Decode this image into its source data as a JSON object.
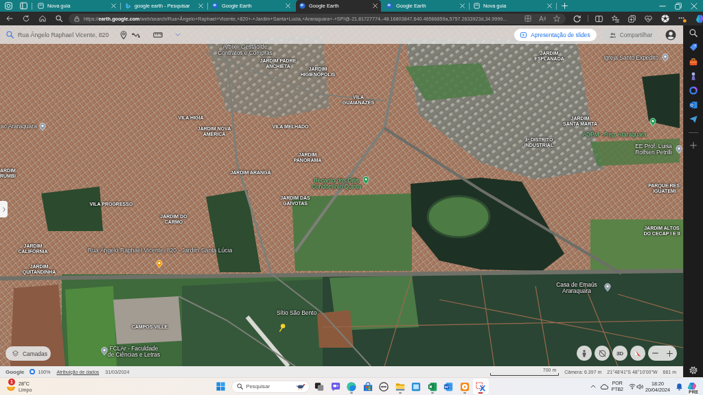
{
  "browser": {
    "tabs": [
      {
        "kind": "new-tab",
        "title": "Nova guia",
        "selected": false
      },
      {
        "kind": "search",
        "title": "google earth - Pesquisar",
        "selected": false
      },
      {
        "kind": "earth",
        "title": "Google Earth",
        "selected": false
      },
      {
        "kind": "earth",
        "title": "Google Earth",
        "selected": true
      },
      {
        "kind": "earth",
        "title": "Google Earth",
        "selected": false
      },
      {
        "kind": "new-tab",
        "title": "Nova guia",
        "selected": false
      }
    ],
    "address_bar": {
      "url": "https://**earth.google.com**/web/search/Rua+Ângelo+Raphael+Vicente,+820+-+Jardim+Santa+Lucia,+Araraquara+-+SP/@-21.81727774,-48.16803847,640.46566859a,5757.2633923d,34.9999..."
    }
  },
  "earth": {
    "search": {
      "value": "Rua Ângelo Raphael Vicente, 820"
    },
    "slideshow_button": "Apresentação de slides",
    "share_button": {
      "label": "Compartilhar",
      "disabled": true
    },
    "map_labels": [
      {
        "kind": "place",
        "lines": [
          "Arbix - Gestão de",
          "Contratos e Compras"
        ]
      },
      {
        "kind": "district",
        "lines": [
          "JARDIM PADRE",
          "ANCHIETA"
        ]
      },
      {
        "kind": "district",
        "lines": [
          "JARDIM",
          "HIGIENÓPOLIS"
        ]
      },
      {
        "kind": "district",
        "lines": [
          "JARDIM",
          "ESPLANADA"
        ]
      },
      {
        "kind": "place",
        "lines": [
          "Igreja Santo Expedito"
        ]
      },
      {
        "kind": "district",
        "lines": [
          "VILA",
          "GUAIANAZES"
        ]
      },
      {
        "kind": "district",
        "lines": [
          "VILA HIGIA"
        ]
      },
      {
        "kind": "district",
        "lines": [
          "JARDIM",
          "SANTA MARTA"
        ]
      },
      {
        "kind": "place",
        "lines": [
          "ac Araraquara"
        ]
      },
      {
        "kind": "district",
        "lines": [
          "VILA MELHADO"
        ]
      },
      {
        "kind": "district",
        "lines": [
          "JARDIM NOVA",
          "AMÉRICA"
        ]
      },
      {
        "kind": "business",
        "lines": [
          "ADPM - Reg. Araraquara"
        ]
      },
      {
        "kind": "district",
        "lines": [
          "3º DISTRITO",
          "INDUSTRIAL"
        ]
      },
      {
        "kind": "place",
        "lines": [
          "EE Prof. Luisa",
          "Rolfsen Petrilli"
        ]
      },
      {
        "kind": "district",
        "lines": [
          "JARDIM",
          "PANORAMA"
        ]
      },
      {
        "kind": "district",
        "lines": [
          "ARDIM",
          "RUMBI"
        ]
      },
      {
        "kind": "district",
        "lines": [
          "JARDIM ARANGÁ"
        ]
      },
      {
        "kind": "business",
        "lines": [
          "Recanto dos Oitis",
          "Condomínio Quinta"
        ]
      },
      {
        "kind": "district",
        "lines": [
          "PARQUE RES.",
          "IGUATEMI"
        ]
      },
      {
        "kind": "district",
        "lines": [
          "VILA PROGRESSO"
        ]
      },
      {
        "kind": "district",
        "lines": [
          "JARDIM DAS",
          "GAIVOTAS"
        ]
      },
      {
        "kind": "district",
        "lines": [
          "JARDIM DO",
          "CARMO"
        ]
      },
      {
        "kind": "district",
        "lines": [
          "JARDIM ALTOS",
          "DO CECAP I E II"
        ]
      },
      {
        "kind": "district",
        "lines": [
          "JARDIM",
          "CALIFÓRNIA"
        ]
      },
      {
        "kind": "result",
        "lines": [
          "Rua Ângelo Raphael Vicente, 820 - Jardim Santa Lúcia"
        ]
      },
      {
        "kind": "district",
        "lines": [
          "JARDIM",
          "QUITANDINHA"
        ]
      },
      {
        "kind": "place",
        "lines": [
          "Casa de Emaús",
          "Araraquara"
        ]
      },
      {
        "kind": "place",
        "lines": [
          "Sítio São Bento"
        ]
      },
      {
        "kind": "district",
        "lines": [
          "CAMPOS VILLE"
        ]
      },
      {
        "kind": "place",
        "lines": [
          "FCLAr - Faculdade",
          "de Ciências e Letras"
        ]
      }
    ],
    "layers_button": "Camadas",
    "view_3d_button": "3D",
    "status_bar": {
      "logo": "Google",
      "quality": "100%",
      "attribution_link": "Atribuição de dados",
      "imagery_date": "31/03/2024",
      "scale": "700 m",
      "camera": "Câmera: 6.397 m",
      "coordinates": "21°48'41\"S 48°10'00\"W",
      "elevation": "661 m"
    }
  },
  "taskbar": {
    "weather": {
      "badge": "1",
      "temperature": "28°C",
      "condition": "Limpo"
    },
    "search": {
      "placeholder": "Pesquisar"
    },
    "apps": [
      {
        "kind": "taskview",
        "running": false,
        "selected": false
      },
      {
        "kind": "chat",
        "running": false,
        "selected": false
      },
      {
        "kind": "browser",
        "running": true,
        "selected": false
      },
      {
        "kind": "store",
        "running": false,
        "selected": false
      },
      {
        "kind": "dell",
        "running": false,
        "selected": false
      },
      {
        "kind": "explorer",
        "running": true,
        "selected": false
      },
      {
        "kind": "webapp",
        "running": false,
        "selected": false
      },
      {
        "kind": "excel",
        "running": true,
        "selected": false
      },
      {
        "kind": "word",
        "running": false,
        "selected": false
      },
      {
        "kind": "media",
        "running": true,
        "selected": false
      },
      {
        "kind": "snip",
        "running": true,
        "selected": true
      }
    ],
    "language": {
      "code": "POR",
      "layout": "PTB2"
    },
    "time": "18:20",
    "date": "20/04/2024",
    "assistant_badge": "PRE"
  }
}
